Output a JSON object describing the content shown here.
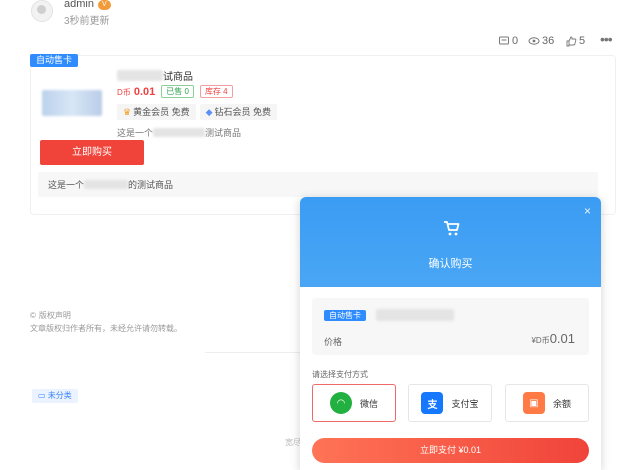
{
  "post": {
    "username": "admin",
    "user_badge": "V",
    "updated": "3秒前更新",
    "comments": "0",
    "views": "36",
    "likes": "5"
  },
  "product": {
    "auto_tag": "自动售卡",
    "title_suffix": "试商品",
    "price_prefix": "D币",
    "price": "0.01",
    "sold": "已售 0",
    "stock": "库存 4",
    "gold_member": "黄金会员 免费",
    "diamond_member": "钻石会员 免费",
    "desc_prefix": "这是一个",
    "desc_suffix": "测试商品",
    "buy_label": "立即购买",
    "desc_box_prefix": "这是一个",
    "desc_box_suffix": "的测试商品"
  },
  "footer": {
    "copyright_title": "版权声明",
    "copyright_text": "文章版权归作者所有，未经允许请勿转载。",
    "category": "未分类",
    "faint_text": "宽尽"
  },
  "modal": {
    "title": "确认购买",
    "close": "×",
    "tag": "自动售卡",
    "price_label": "价格",
    "price_prefix": "¥D币",
    "price": "0.01",
    "pay_method_label": "请选择支付方式",
    "pay_options": [
      {
        "label": "微信",
        "icon": "wechat-icon",
        "color": "#22b140",
        "selected": true
      },
      {
        "label": "支付宝",
        "icon": "alipay-icon",
        "color": "#1677ff",
        "selected": false
      },
      {
        "label": "余额",
        "icon": "wallet-icon",
        "color": "#ff7a45",
        "selected": false
      }
    ],
    "confirm_label": "立即支付  ¥0.01"
  },
  "colors": {
    "accent_blue": "#2f8cff",
    "buy_red": "#f0443a",
    "modal_header": "#3a9cf3"
  }
}
